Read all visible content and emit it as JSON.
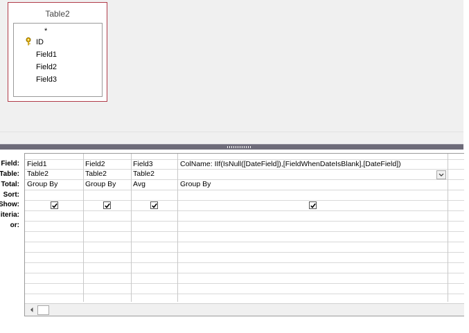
{
  "table": {
    "name": "Table2",
    "fields": [
      "*",
      "ID",
      "Field1",
      "Field2",
      "Field3"
    ]
  },
  "row_labels": [
    "Field:",
    "Table:",
    "Total:",
    "Sort:",
    "Show:",
    "iteria:",
    "or:"
  ],
  "columns": [
    {
      "field": "Field1",
      "table": "Table2",
      "total": "Group By",
      "show": true
    },
    {
      "field": "Field2",
      "table": "Table2",
      "total": "Group By",
      "show": true
    },
    {
      "field": "Field3",
      "table": "Table2",
      "total": "Avg",
      "show": true
    },
    {
      "field": "ColName: IIf(IsNull([DateField]),[FieldWhenDateIsBlank],[DateField])",
      "table": "",
      "total": "Group By",
      "show": true
    }
  ],
  "icons": {
    "primary_key": "key-icon",
    "dropdown": "chevron-down-icon",
    "scroll_left": "arrow-left-icon"
  }
}
